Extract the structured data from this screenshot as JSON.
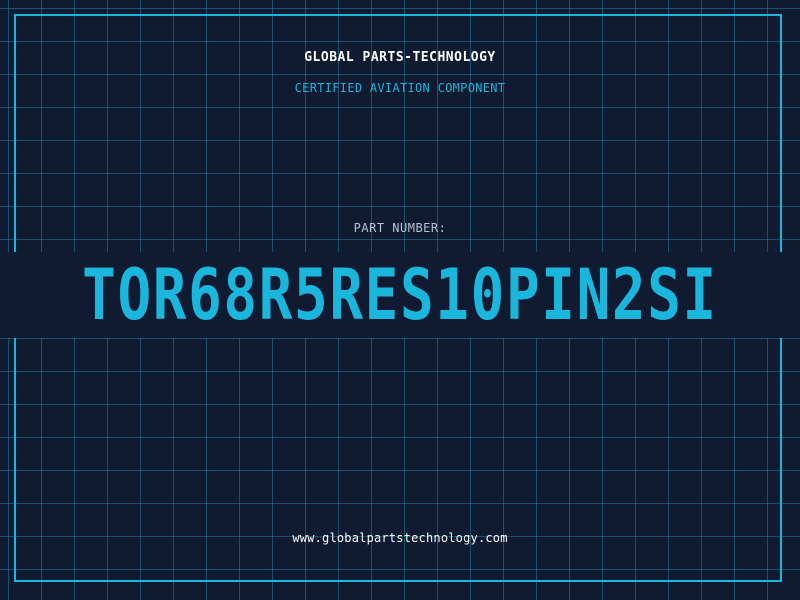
{
  "header": {
    "company": "GLOBAL PARTS-TECHNOLOGY",
    "subtitle": "CERTIFIED AVIATION COMPONENT"
  },
  "part": {
    "label": "PART NUMBER:",
    "value": "TOR68R5RES10PIN2SI"
  },
  "footer": {
    "website": "www.globalpartstechnology.com"
  },
  "colors": {
    "background": "#101a30",
    "grid": "#1f6f8c",
    "accent": "#1bb6dc",
    "text_primary": "#ffffff",
    "text_muted": "#b8c2d0"
  }
}
